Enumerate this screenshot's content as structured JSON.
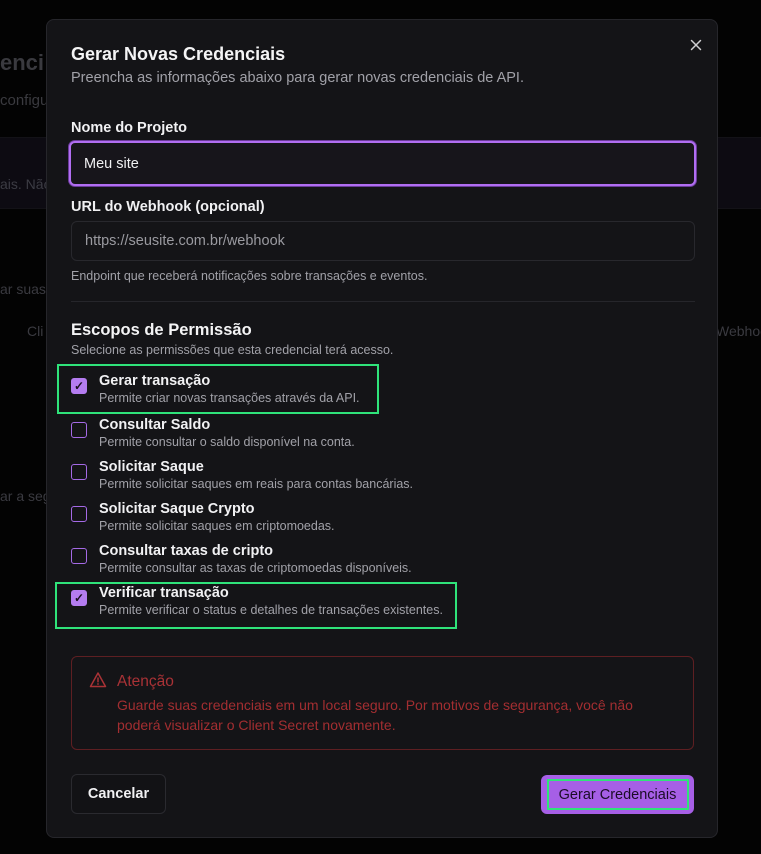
{
  "background": {
    "title_fragment": "enci",
    "subtitle_fragment": "configu",
    "band_fragment": "ais. Não",
    "text_fragment_1": "ar suas",
    "text_fragment_2": "Cli",
    "text_fragment_3": "Webhoo",
    "text_fragment_4": "ar a seg"
  },
  "modal": {
    "title": "Gerar Novas Credenciais",
    "description": "Preencha as informações abaixo para gerar novas credenciais de API.",
    "close_icon": "x-icon",
    "project_name": {
      "label": "Nome do Projeto",
      "value": "Meu site"
    },
    "webhook": {
      "label": "URL do Webhook (opcional)",
      "placeholder": "https://seusite.com.br/webhook",
      "hint": "Endpoint que receberá notificações sobre transações e eventos."
    },
    "scopes": {
      "title": "Escopos de Permissão",
      "description": "Selecione as permissões que esta credencial terá acesso.",
      "items": [
        {
          "name": "Gerar transação",
          "description": "Permite criar novas transações através da API.",
          "checked": true
        },
        {
          "name": "Consultar Saldo",
          "description": "Permite consultar o saldo disponível na conta.",
          "checked": false
        },
        {
          "name": "Solicitar Saque",
          "description": "Permite solicitar saques em reais para contas bancárias.",
          "checked": false
        },
        {
          "name": "Solicitar Saque Crypto",
          "description": "Permite solicitar saques em criptomoedas.",
          "checked": false
        },
        {
          "name": "Consultar taxas de cripto",
          "description": "Permite consultar as taxas de criptomoedas disponíveis.",
          "checked": false
        },
        {
          "name": "Verificar transação",
          "description": "Permite verificar o status e detalhes de transações existentes.",
          "checked": true
        }
      ]
    },
    "alert": {
      "icon": "warning-triangle-icon",
      "title": "Atenção",
      "text": "Guarde suas credenciais em um local seguro. Por motivos de segurança, você não poderá visualizar o Client Secret novamente."
    },
    "buttons": {
      "cancel": "Cancelar",
      "submit": "Gerar Credenciais"
    }
  },
  "colors": {
    "accent": "#a65fe6",
    "highlight": "#2fe37a",
    "danger": "#a93236",
    "surface": "#141417"
  }
}
